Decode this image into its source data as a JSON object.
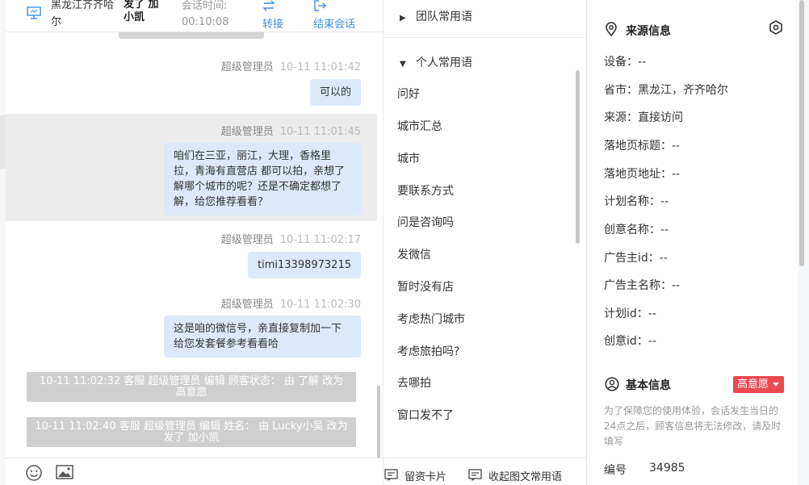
{
  "chat_header": {
    "location": "黑龙江齐齐哈尔",
    "visitor_name": "发了 加 小凯",
    "session_time_label": "会话时间:",
    "session_time": "00:10:08",
    "transfer_label": "转接",
    "end_label": "结束会话"
  },
  "messages": [
    {
      "sender": "超级管理员",
      "time": "10-11 11:01:42",
      "text": "可以的"
    },
    {
      "sender": "超级管理员",
      "time": "10-11 11:01:45",
      "text": "咱们在三亚，丽江，大理，香格里拉，青海有直营店 都可以拍，亲想了解哪个城市的呢？还是不确定都想了解，给您推荐看看？"
    },
    {
      "sender": "超级管理员",
      "time": "10-11 11:02:17",
      "text": "timi13398973215"
    },
    {
      "sender": "超级管理员",
      "time": "10-11 11:02:30",
      "text": "这是咱的微信号，亲直接复制加一下给您发套餐参考看看哈"
    }
  ],
  "system_messages": [
    "10-11 11:02:32 客服 超级管理员 编辑 顾客状态： 由 了解 改为 高意愿",
    "10-11 11:02:40 客服 超级管理员 编辑 姓名： 由 Lucky小吴 改为 发了 加小凯"
  ],
  "phrases": {
    "team_group": "团队常用语",
    "personal_group": "个人常用语",
    "items": [
      "问好",
      "城市汇总",
      "城市",
      "要联系方式",
      "问是咨询吗",
      "发微信",
      "暂时没有店",
      "考虑热门城市",
      "考虑旅拍吗?",
      "去哪拍",
      "窗口发不了"
    ],
    "card_button": "留资卡片",
    "collapse_button": "收起图文常用语"
  },
  "source_info": {
    "title": "来源信息",
    "fields": [
      "设备：--",
      "省市：黑龙江，齐齐哈尔",
      "来源：直接访问",
      "落地页标题：--",
      "落地页地址：--",
      "计划名称：--",
      "创意名称：--",
      "广告主id：--",
      "广告主名称：--",
      "计划id：--",
      "创意id：--"
    ]
  },
  "basic_info": {
    "title": "基本信息",
    "intent_badge": "高意愿",
    "notice": "为了保障您的使用体验，会话发生当日的24点之后，顾客信息将无法修改，请及时填写",
    "number_label": "编号",
    "number_value": "34985"
  },
  "colors": {
    "accent_blue": "#3a8ee6",
    "bubble_bg": "#dde9fb",
    "badge_red": "#e9494f",
    "system_msg_bg": "#cfcfcf"
  }
}
